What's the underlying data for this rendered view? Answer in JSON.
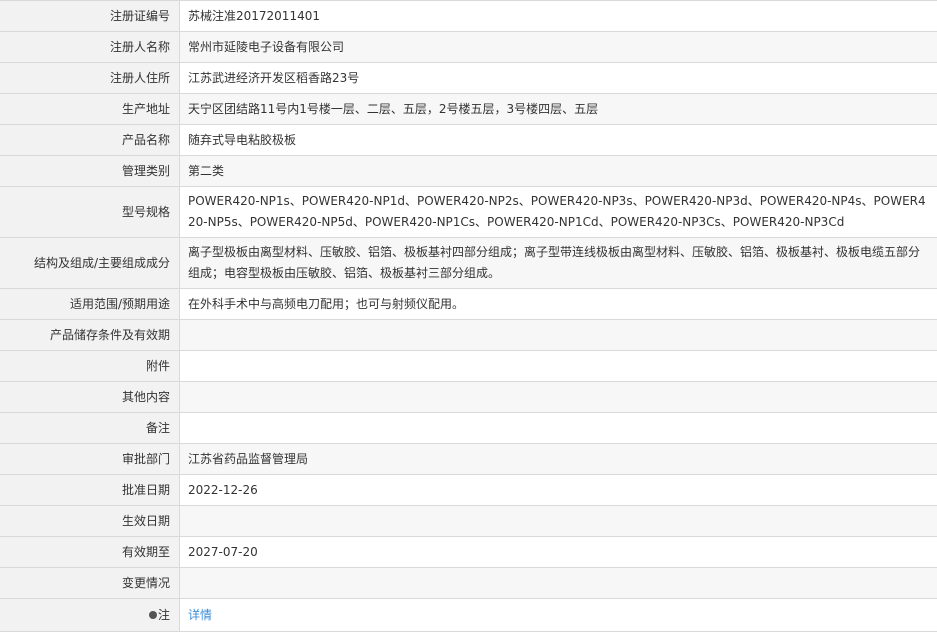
{
  "rows": [
    {
      "label": "注册证编号",
      "value": "苏械注准20172011401"
    },
    {
      "label": "注册人名称",
      "value": "常州市延陵电子设备有限公司"
    },
    {
      "label": "注册人住所",
      "value": "江苏武进经济开发区稻香路23号"
    },
    {
      "label": "生产地址",
      "value": "天宁区团结路11号内1号楼一层、二层、五层，2号楼五层，3号楼四层、五层"
    },
    {
      "label": "产品名称",
      "value": "随弃式导电粘胶极板"
    },
    {
      "label": "管理类别",
      "value": "第二类"
    },
    {
      "label": "型号规格",
      "value": "POWER420-NP1s、POWER420-NP1d、POWER420-NP2s、POWER420-NP3s、POWER420-NP3d、POWER420-NP4s、POWER420-NP5s、POWER420-NP5d、POWER420-NP1Cs、POWER420-NP1Cd、POWER420-NP3Cs、POWER420-NP3Cd"
    },
    {
      "label": "结构及组成/主要组成成分",
      "value": "离子型极板由离型材料、压敏胶、铝箔、极板基衬四部分组成；离子型带连线极板由离型材料、压敏胶、铝箔、极板基衬、极板电缆五部分组成；电容型极板由压敏胶、铝箔、极板基衬三部分组成。"
    },
    {
      "label": "适用范围/预期用途",
      "value": "在外科手术中与高频电刀配用；也可与射频仪配用。"
    },
    {
      "label": "产品储存条件及有效期",
      "value": ""
    },
    {
      "label": "附件",
      "value": ""
    },
    {
      "label": "其他内容",
      "value": ""
    },
    {
      "label": "备注",
      "value": ""
    },
    {
      "label": "审批部门",
      "value": "江苏省药品监督管理局"
    },
    {
      "label": "批准日期",
      "value": "2022-12-26"
    },
    {
      "label": "生效日期",
      "value": ""
    },
    {
      "label": "有效期至",
      "value": "2027-07-20"
    },
    {
      "label": "变更情况",
      "value": ""
    },
    {
      "label": "注",
      "value": "详情"
    }
  ],
  "colors": {
    "label_bg": "#f2f2f2",
    "alt_row_bg": "#f7f7f7",
    "border": "#d9d9d9",
    "text": "#333333",
    "link": "#3c8dd9"
  },
  "icons": {
    "note": "note-bulb-icon"
  }
}
